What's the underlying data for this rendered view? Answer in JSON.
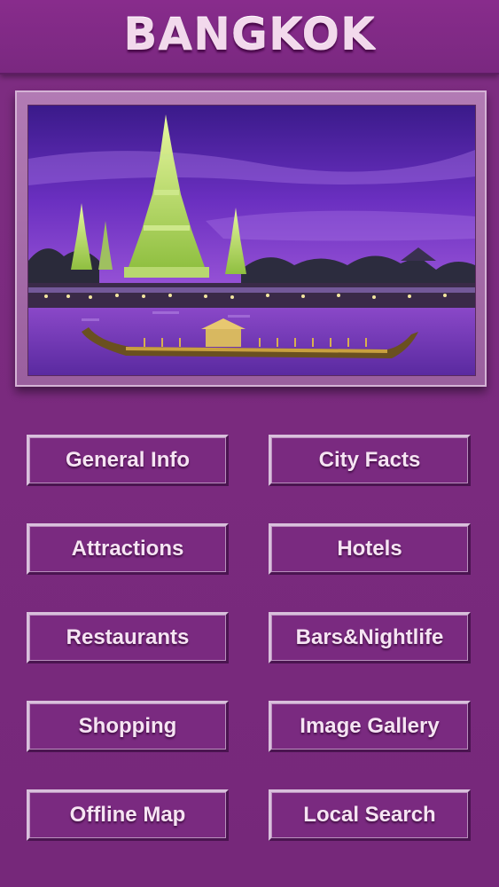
{
  "header": {
    "title": "BANGKOK"
  },
  "hero_image": {
    "subject": "Wat Arun temple at dusk with royal barge on the Chao Phraya river"
  },
  "menu": {
    "general_info": "General Info",
    "city_facts": "City Facts",
    "attractions": "Attractions",
    "hotels": "Hotels",
    "restaurants": "Restaurants",
    "bars_nightlife": "Bars&Nightlife",
    "shopping": "Shopping",
    "image_gallery": "Image Gallery",
    "offline_map": "Offline Map",
    "local_search": "Local Search"
  },
  "colors": {
    "background": "#7a2a7e",
    "button_text": "#f6e4f3",
    "title_text": "#f2d9ec"
  }
}
